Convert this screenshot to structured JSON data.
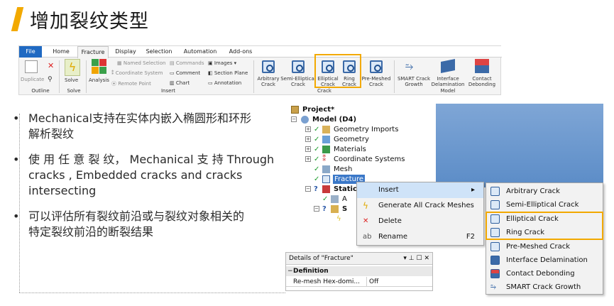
{
  "slide": {
    "title": "增加裂纹类型",
    "accent": "#f2a900"
  },
  "ribbon": {
    "tabs": [
      "File",
      "Home",
      "Fracture",
      "Display",
      "Selection",
      "Automation",
      "Add-ons"
    ],
    "active_tab": "Fracture",
    "outline": {
      "duplicate": "Duplicate",
      "group": "Outline"
    },
    "solve": {
      "label": "Solve",
      "group": "Solve"
    },
    "insert": {
      "analysis": "Analysis",
      "named_selection": "Named Selection",
      "coordinate_system": "Coordinate System",
      "remote_point": "Remote Point",
      "commands": "Commands",
      "comment": "Comment",
      "chart": "Chart",
      "images": "Images",
      "section_plane": "Section Plane",
      "annotation": "Annotation",
      "group": "Insert"
    },
    "crack": {
      "arbitrary": [
        "Arbitrary",
        "Crack"
      ],
      "semi_elliptical": [
        "Semi-Elliptical",
        "Crack"
      ],
      "elliptical": [
        "Elliptical",
        "Crack"
      ],
      "ring": [
        "Ring",
        "Crack"
      ],
      "pre_meshed": [
        "Pre-Meshed",
        "Crack"
      ],
      "group": "Crack"
    },
    "model": {
      "smart": [
        "SMART Crack",
        "Growth"
      ],
      "interface": [
        "Interface",
        "Delamination"
      ],
      "contact": [
        "Contact",
        "Debonding"
      ],
      "group": "Model"
    }
  },
  "bullets": [
    [
      "Mechanical支持在实体内嵌入椭圆形和环形",
      "解析裂纹"
    ],
    [
      "使 用 任 意 裂 纹， Mechanical 支 持 Through",
      "cracks ,   Embedded   cracks   and   cracks",
      "intersecting"
    ],
    [
      "可以评估所有裂纹前沿或与裂纹对象相关的",
      "特定裂纹前沿的断裂结果"
    ]
  ],
  "tree": {
    "project": "Project*",
    "model": "Model (D4)",
    "items": [
      "Geometry Imports",
      "Geometry",
      "Materials",
      "Coordinate Systems",
      "Mesh",
      "Fracture"
    ],
    "static": "Static",
    "sub_a": "A",
    "sub_s": "S"
  },
  "context_menu": {
    "items": [
      {
        "label": "Insert",
        "shortcut": ""
      },
      {
        "label": "Generate All Crack Meshes",
        "shortcut": ""
      },
      {
        "label": "Delete",
        "shortcut": ""
      },
      {
        "label": "Rename",
        "shortcut": "F2"
      }
    ]
  },
  "submenu": {
    "items": [
      "Arbitrary Crack",
      "Semi-Elliptical Crack",
      "Elliptical Crack",
      "Ring Crack",
      "Pre-Meshed Crack",
      "Interface Delamination",
      "Contact Debonding",
      "SMART Crack Growth"
    ]
  },
  "details": {
    "title": "Details of \"Fracture\"",
    "section": "Definition",
    "row_key": "Re-mesh Hex-domi...",
    "row_value": "Off"
  }
}
